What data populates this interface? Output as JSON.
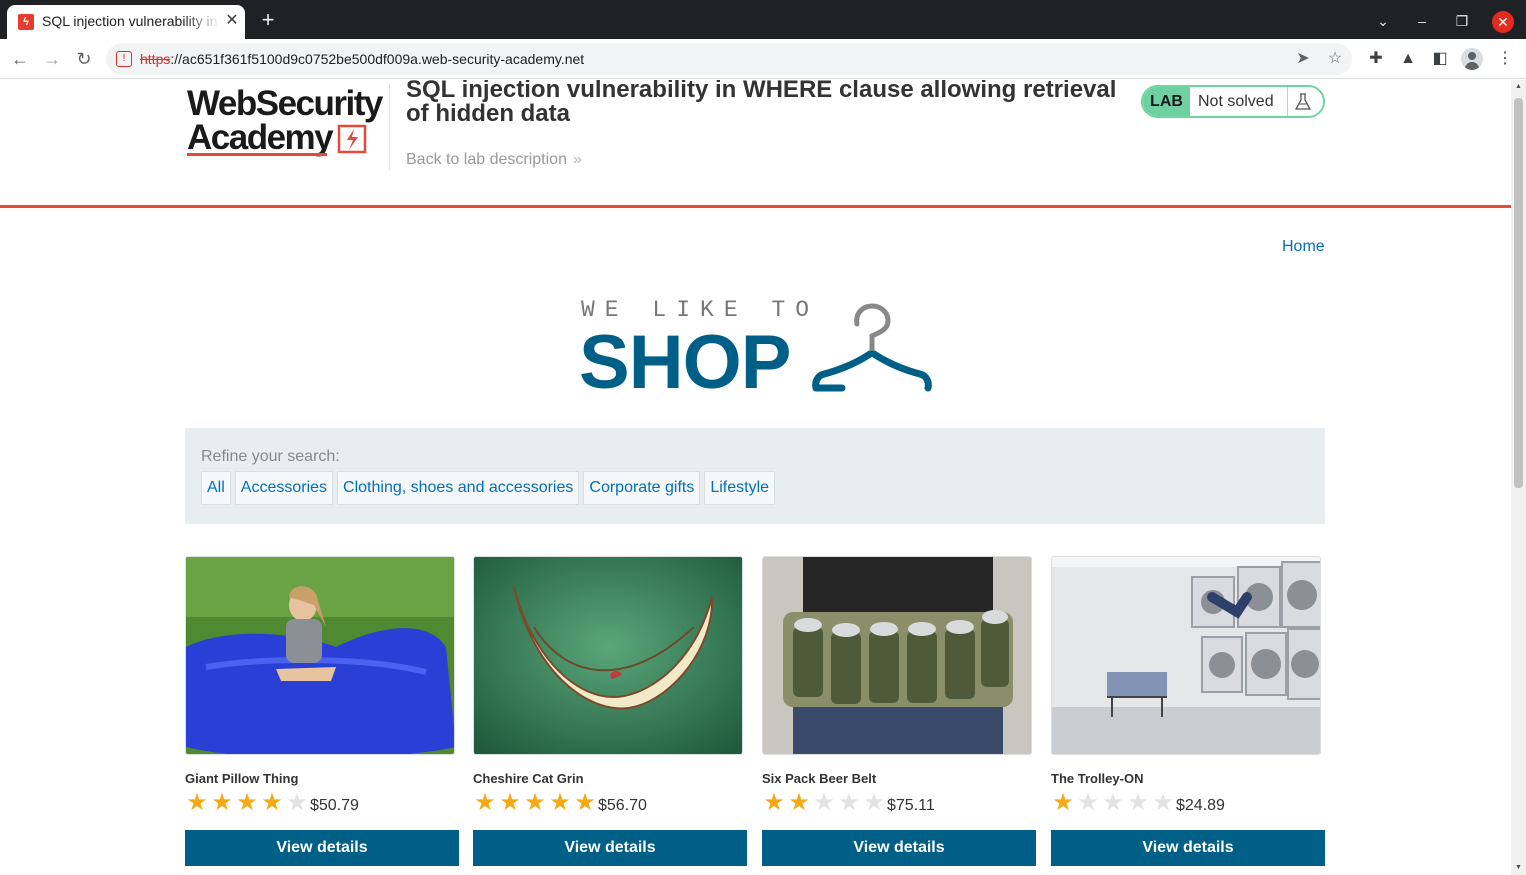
{
  "browser": {
    "tab_title": "SQL injection vulnerability in WHERE clause allowing retrieval of hidden data",
    "tab_close": "✕",
    "new_tab": "+",
    "url_scheme": "https",
    "url_rest": "://ac651f361f5100d9c0752be500df009a.web-security-academy.net"
  },
  "header": {
    "logo_line1": "WebSecurity",
    "logo_line2": "Academy",
    "lab_title": "SQL injection vulnerability in WHERE clause allowing retrieval of hidden data",
    "back_link": "Back to lab description",
    "back_chevron": "»",
    "badge_lab": "LAB",
    "badge_status": "Not solved",
    "badge_status_color": "#70d0a2"
  },
  "nav": {
    "home": "Home"
  },
  "shop": {
    "tagline": "WE LIKE TO",
    "word": "SHOP"
  },
  "refine": {
    "label": "Refine your search:",
    "filters": [
      "All",
      "Accessories",
      "Clothing, shoes and accessories",
      "Corporate gifts",
      "Lifestyle"
    ]
  },
  "products": [
    {
      "name": "Giant Pillow Thing",
      "rating": 4,
      "price": "$50.79",
      "button": "View details"
    },
    {
      "name": "Cheshire Cat Grin",
      "rating": 5,
      "price": "$56.70",
      "button": "View details"
    },
    {
      "name": "Six Pack Beer Belt",
      "rating": 2,
      "price": "$75.11",
      "button": "View details"
    },
    {
      "name": "The Trolley-ON",
      "rating": 1,
      "price": "$24.89",
      "button": "View details"
    }
  ],
  "colors": {
    "accent": "#e24a3a",
    "brand": "#005f87",
    "link": "#0071bc",
    "star": "#f4a915"
  }
}
